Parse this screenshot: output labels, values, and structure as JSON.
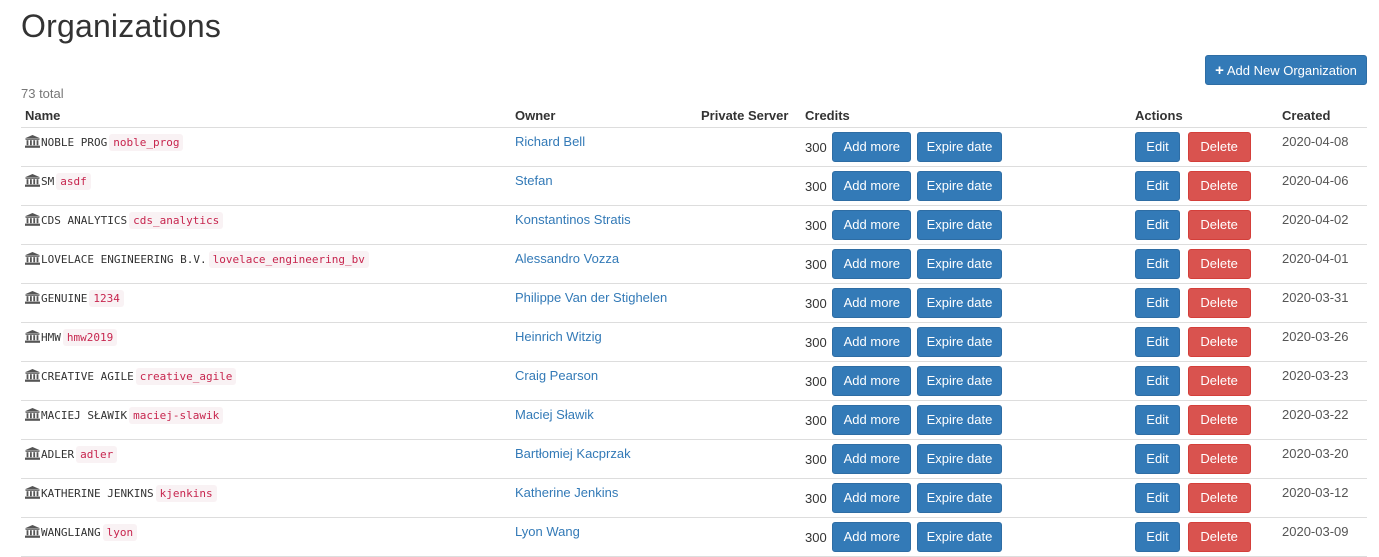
{
  "page": {
    "title": "Organizations",
    "total": "73 total",
    "add_button": "Add New Organization"
  },
  "table": {
    "headers": {
      "name": "Name",
      "owner": "Owner",
      "private_server": "Private Server",
      "credits": "Credits",
      "actions": "Actions",
      "created": "Created"
    },
    "labels": {
      "add_more": "Add more",
      "expire_date": "Expire date",
      "edit": "Edit",
      "delete": "Delete"
    },
    "rows": [
      {
        "name": "NOBLE PROG",
        "slug": "noble_prog",
        "owner": "Richard Bell",
        "private_server": "",
        "credits": "300",
        "created": "2020-04-08"
      },
      {
        "name": "SM",
        "slug": "asdf",
        "owner": "Stefan",
        "private_server": "",
        "credits": "300",
        "created": "2020-04-06"
      },
      {
        "name": "CDS ANALYTICS",
        "slug": "cds_analytics",
        "owner": "Konstantinos Stratis",
        "private_server": "",
        "credits": "300",
        "created": "2020-04-02"
      },
      {
        "name": "LOVELACE ENGINEERING B.V.",
        "slug": "lovelace_engineering_bv",
        "owner": "Alessandro Vozza",
        "private_server": "",
        "credits": "300",
        "created": "2020-04-01"
      },
      {
        "name": "GENUINE",
        "slug": "1234",
        "owner": "Philippe Van der Stighelen",
        "private_server": "",
        "credits": "300",
        "created": "2020-03-31"
      },
      {
        "name": "HMW",
        "slug": "hmw2019",
        "owner": "Heinrich Witzig",
        "private_server": "",
        "credits": "300",
        "created": "2020-03-26"
      },
      {
        "name": "CREATIVE AGILE",
        "slug": "creative_agile",
        "owner": "Craig Pearson",
        "private_server": "",
        "credits": "300",
        "created": "2020-03-23"
      },
      {
        "name": "MACIEJ SŁAWIK",
        "slug": "maciej-slawik",
        "owner": "Maciej Sławik",
        "private_server": "",
        "credits": "300",
        "created": "2020-03-22"
      },
      {
        "name": "ADLER",
        "slug": "adler",
        "owner": "Bartłomiej Kacprzak",
        "private_server": "",
        "credits": "300",
        "created": "2020-03-20"
      },
      {
        "name": "KATHERINE JENKINS",
        "slug": "kjenkins",
        "owner": "Katherine Jenkins",
        "private_server": "",
        "credits": "300",
        "created": "2020-03-12"
      },
      {
        "name": "WANGLIANG",
        "slug": "lyon",
        "owner": "Lyon Wang",
        "private_server": "",
        "credits": "300",
        "created": "2020-03-09"
      }
    ]
  },
  "icons": {
    "add": "plus-icon",
    "organization": "bank-icon"
  },
  "colors": {
    "primary": "#337ab7",
    "danger": "#d9534f",
    "slug_text": "#c7254e",
    "slug_bg": "#f9f2f4"
  }
}
